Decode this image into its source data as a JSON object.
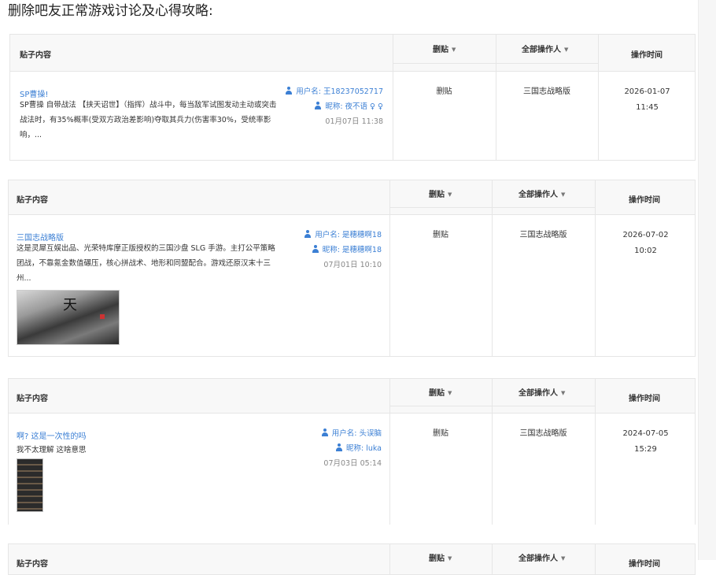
{
  "page_heading": "删除吧友正常游戏讨论及心得攻略:",
  "columns": {
    "content": "贴子内容",
    "action": "删贴",
    "operator": "全部操作人",
    "time": "操作时间"
  },
  "posts": [
    {
      "title": "SP曹操!",
      "desc": "SP曹操 自带战法 【挟天诏世】（指挥）战斗中，每当敌军试图发动主动或突击战法时，有35%概率(受双方政治差影响)夺取其兵力(伤害率30%，受统率影响，...",
      "username": "用户名: 王18237052717",
      "nickname": "昵称: 夜不语 ♀ ♀",
      "post_time": "01月07日 11:38",
      "action": "删贴",
      "operator": "三国志战略版",
      "op_date": "2026-01-07",
      "op_time": "11:45"
    },
    {
      "title": "三国志战略版",
      "desc": "这是灵犀互娱出品、光荣特库摩正版授权的三国沙盘 SLG 手游。主打公平策略团战，不靠氪金数值碾压，核心拼战术、地形和同盟配合。游戏还原汉末十三州...",
      "username": "用户名: 是穗穗啊18",
      "nickname": "昵称: 是穗穗啊18",
      "post_time": "07月01日 10:10",
      "action": "删贴",
      "operator": "三国志战略版",
      "op_date": "2026-07-02",
      "op_time": "10:02"
    },
    {
      "title": "啊? 这是一次性的吗",
      "desc": "我不太理解 这啥意思",
      "username": "用户名: 头误脑",
      "nickname": "昵称: luka",
      "post_time": "07月03日 05:14",
      "action": "删贴",
      "operator": "三国志战略版",
      "op_date": "2024-07-05",
      "op_time": "15:29"
    }
  ],
  "icons": [
    "user-icon",
    "chevron-right-icon",
    "caret-down-icon"
  ]
}
